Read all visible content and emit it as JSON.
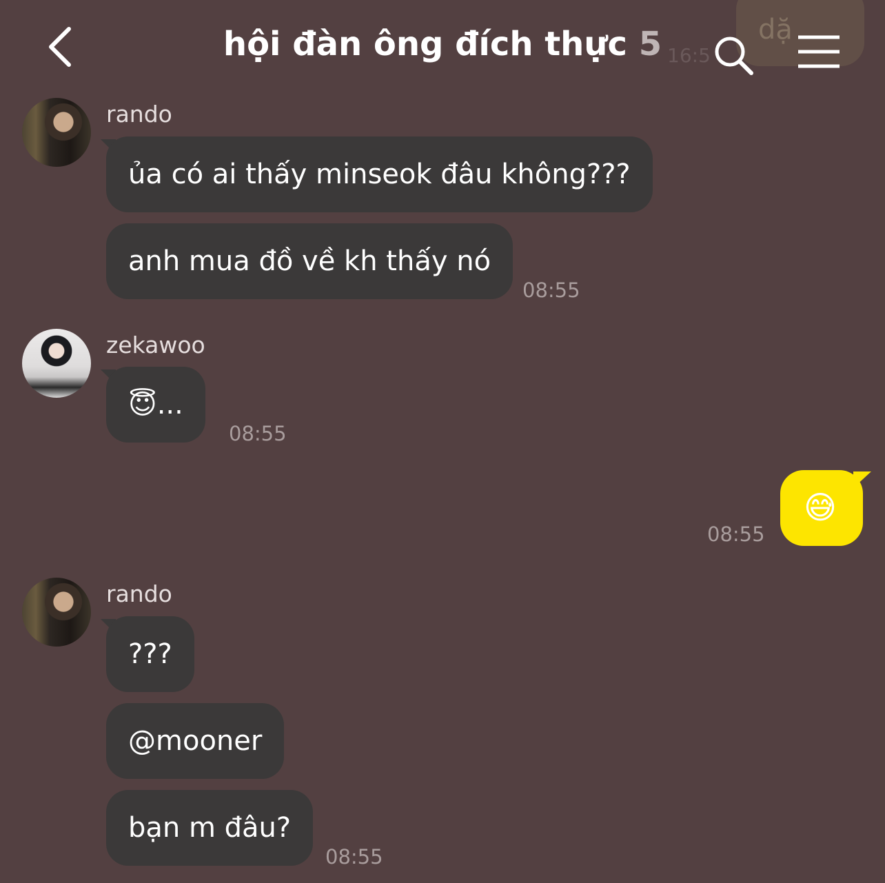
{
  "background_color": "#534041",
  "header": {
    "title": "hội đàn ông đích thực",
    "member_count": "5",
    "back_icon": "chevron-left-icon",
    "search_icon": "search-icon",
    "menu_icon": "hamburger-menu-icon"
  },
  "overlay": {
    "text": "dặ",
    "time": "16:5"
  },
  "messages": [
    {
      "sender": "rando",
      "bubbles": [
        "ủa có ai thấy minseok đâu không???",
        "anh mua đồ về kh thấy nó"
      ],
      "time": "08:55"
    },
    {
      "sender": "zekawoo",
      "bubbles": [
        "😇..."
      ],
      "time": "08:55"
    },
    {
      "sender": "me",
      "bubbles": [
        "😅"
      ],
      "time": "08:55",
      "bubble_color": "#fde500"
    },
    {
      "sender": "rando",
      "bubbles": [
        "???",
        "@mooner",
        "bạn m đâu?"
      ],
      "time": "08:55"
    }
  ]
}
